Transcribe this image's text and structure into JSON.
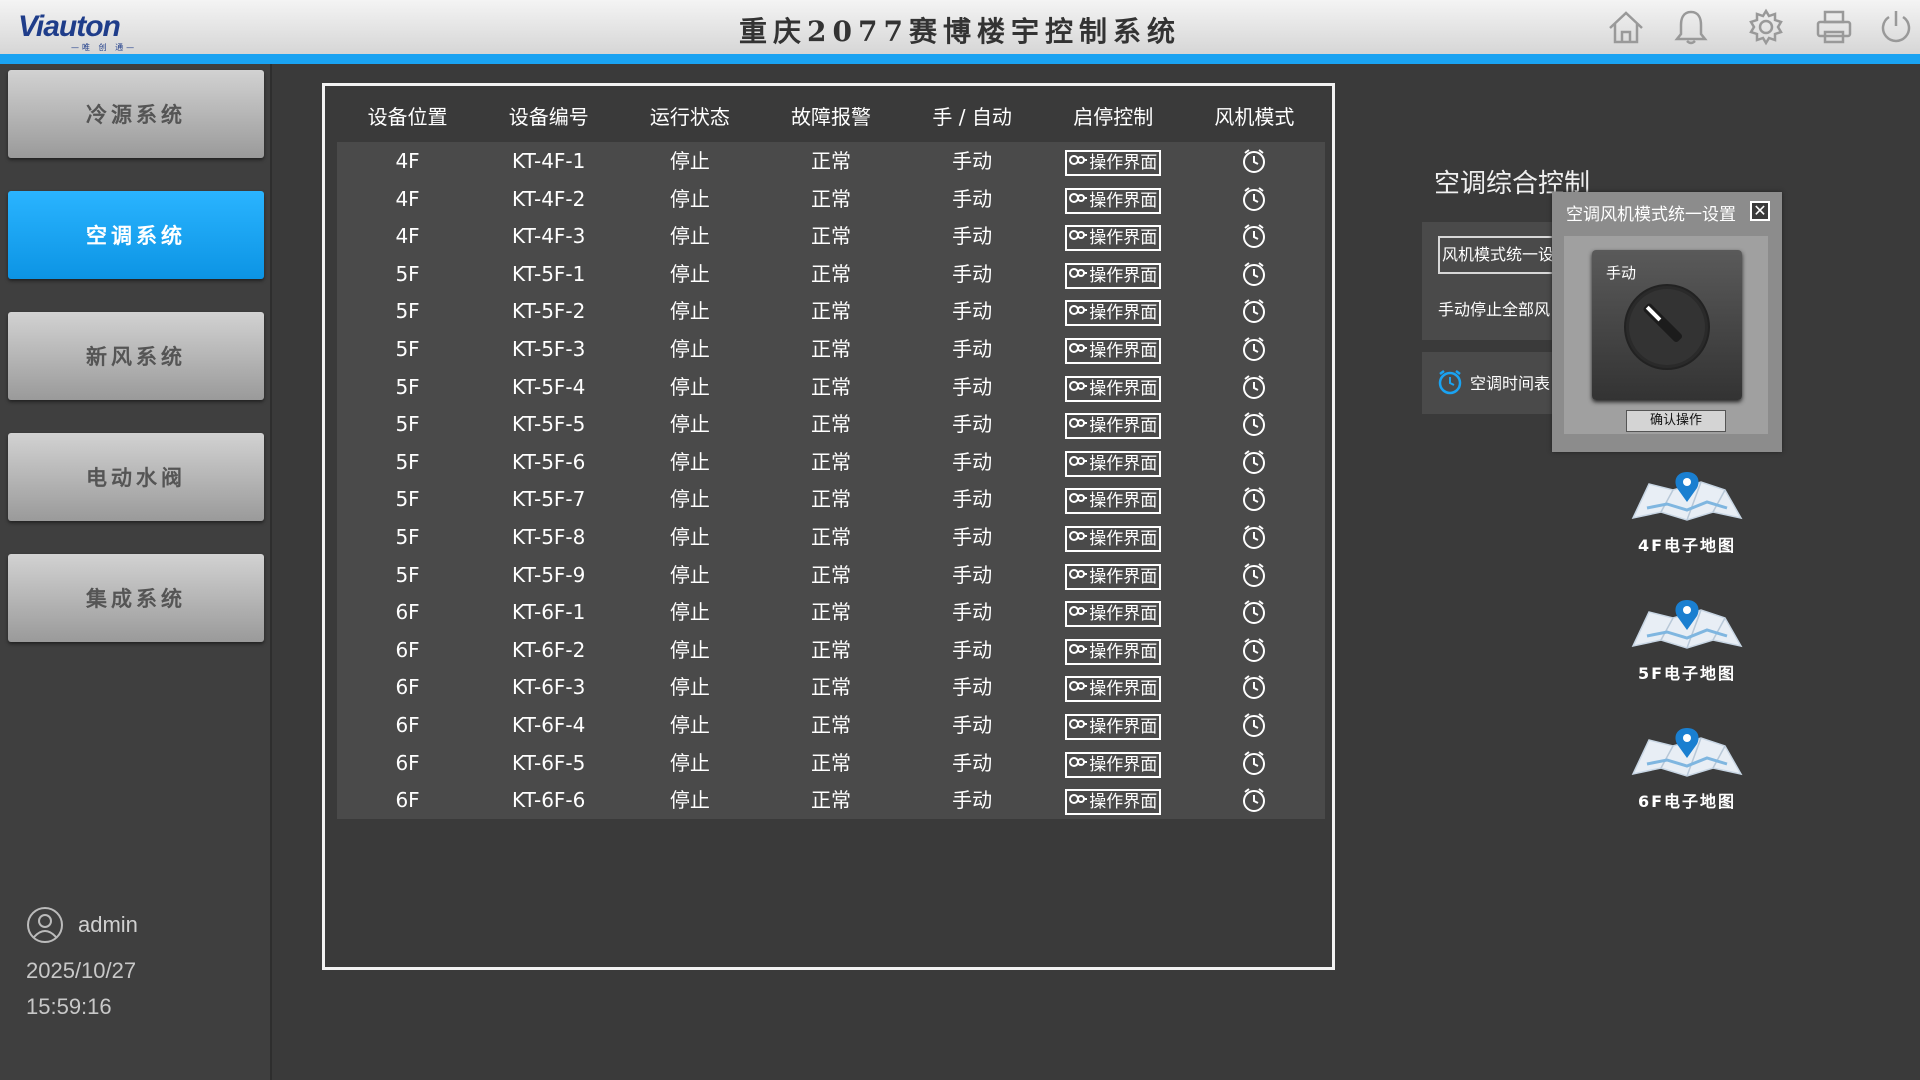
{
  "header": {
    "logo_text": "Viauton",
    "logo_sub": "—唯 创 通—",
    "title": "重庆2077赛博楼宇控制系统",
    "icons": [
      "home-icon",
      "bell-icon",
      "gear-icon",
      "printer-icon",
      "power-icon"
    ]
  },
  "sidebar": {
    "items": [
      {
        "label": "冷源系统",
        "active": false
      },
      {
        "label": "空调系统",
        "active": true
      },
      {
        "label": "新风系统",
        "active": false
      },
      {
        "label": "电动水阀",
        "active": false
      },
      {
        "label": "集成系统",
        "active": false
      }
    ],
    "user": "admin",
    "date": "2025/10/27",
    "time": "15:59:16"
  },
  "table": {
    "headers": [
      "设备位置",
      "设备编号",
      "运行状态",
      "故障报警",
      "手 / 自动",
      "启停控制",
      "风机模式"
    ],
    "op_label": "操作界面",
    "rows": [
      {
        "floor": "4F",
        "id": "KT-4F-1",
        "status": "停止",
        "alarm": "正常",
        "mode": "手动"
      },
      {
        "floor": "4F",
        "id": "KT-4F-2",
        "status": "停止",
        "alarm": "正常",
        "mode": "手动"
      },
      {
        "floor": "4F",
        "id": "KT-4F-3",
        "status": "停止",
        "alarm": "正常",
        "mode": "手动"
      },
      {
        "floor": "5F",
        "id": "KT-5F-1",
        "status": "停止",
        "alarm": "正常",
        "mode": "手动"
      },
      {
        "floor": "5F",
        "id": "KT-5F-2",
        "status": "停止",
        "alarm": "正常",
        "mode": "手动"
      },
      {
        "floor": "5F",
        "id": "KT-5F-3",
        "status": "停止",
        "alarm": "正常",
        "mode": "手动"
      },
      {
        "floor": "5F",
        "id": "KT-5F-4",
        "status": "停止",
        "alarm": "正常",
        "mode": "手动"
      },
      {
        "floor": "5F",
        "id": "KT-5F-5",
        "status": "停止",
        "alarm": "正常",
        "mode": "手动"
      },
      {
        "floor": "5F",
        "id": "KT-5F-6",
        "status": "停止",
        "alarm": "正常",
        "mode": "手动"
      },
      {
        "floor": "5F",
        "id": "KT-5F-7",
        "status": "停止",
        "alarm": "正常",
        "mode": "手动"
      },
      {
        "floor": "5F",
        "id": "KT-5F-8",
        "status": "停止",
        "alarm": "正常",
        "mode": "手动"
      },
      {
        "floor": "5F",
        "id": "KT-5F-9",
        "status": "停止",
        "alarm": "正常",
        "mode": "手动"
      },
      {
        "floor": "6F",
        "id": "KT-6F-1",
        "status": "停止",
        "alarm": "正常",
        "mode": "手动"
      },
      {
        "floor": "6F",
        "id": "KT-6F-2",
        "status": "停止",
        "alarm": "正常",
        "mode": "手动"
      },
      {
        "floor": "6F",
        "id": "KT-6F-3",
        "status": "停止",
        "alarm": "正常",
        "mode": "手动"
      },
      {
        "floor": "6F",
        "id": "KT-6F-4",
        "status": "停止",
        "alarm": "正常",
        "mode": "手动"
      },
      {
        "floor": "6F",
        "id": "KT-6F-5",
        "status": "停止",
        "alarm": "正常",
        "mode": "手动"
      },
      {
        "floor": "6F",
        "id": "KT-6F-6",
        "status": "停止",
        "alarm": "正常",
        "mode": "手动"
      }
    ]
  },
  "ac_control": {
    "title": "空调综合控制",
    "fan_mode_field": "风机模式统一设",
    "stop_all": "手动停止全部风",
    "schedule": "空调时间表"
  },
  "popup": {
    "title": "空调风机模式统一设置",
    "close": "✕",
    "knob_label": "手动",
    "confirm": "确认操作"
  },
  "maps": [
    {
      "label": "4F电子地图"
    },
    {
      "label": "5F电子地图"
    },
    {
      "label": "6F电子地图"
    }
  ],
  "colors": {
    "accent": "#1aa3f2",
    "background": "#3a3a3a",
    "row": "#4a4a4a"
  }
}
